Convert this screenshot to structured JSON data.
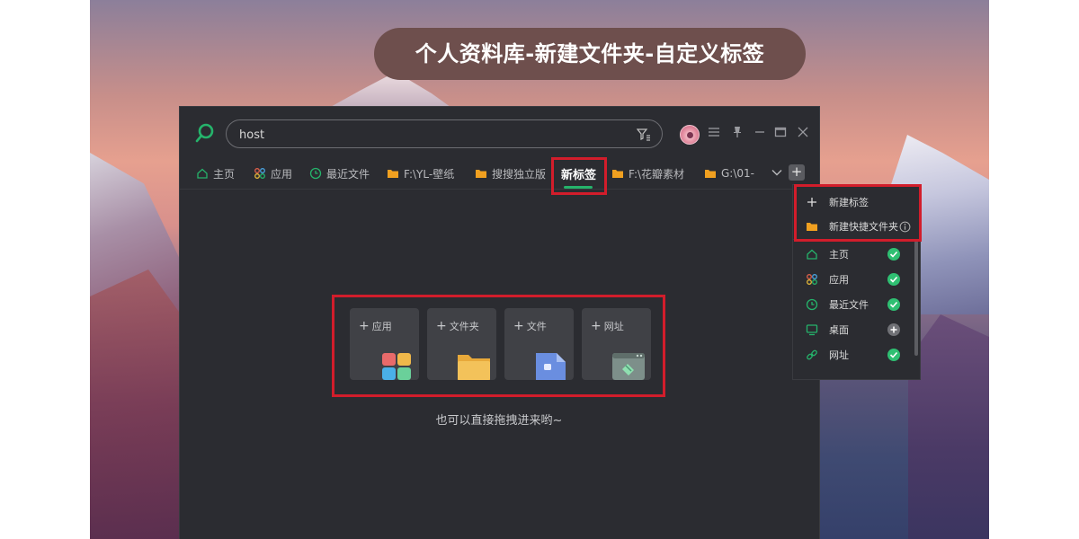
{
  "banner_title": "个人资料库-新建文件夹-自定义标签",
  "search": {
    "value": "host"
  },
  "tabs": [
    {
      "label": "主页",
      "icon": "home-icon"
    },
    {
      "label": "应用",
      "icon": "apps-icon"
    },
    {
      "label": "最近文件",
      "icon": "clock-icon"
    },
    {
      "label": "F:\\YL-壁纸",
      "icon": "folder-icon"
    },
    {
      "label": "搜搜独立版",
      "icon": "folder-icon"
    },
    {
      "label": "新标签",
      "icon": "",
      "active": true
    },
    {
      "label": "F:\\花瓣素材",
      "icon": "folder-icon"
    },
    {
      "label": "G:\\01-",
      "icon": "folder-icon"
    }
  ],
  "cards": [
    {
      "label": "应用",
      "icon": "apps-tile-icon"
    },
    {
      "label": "文件夹",
      "icon": "folder-tile-icon"
    },
    {
      "label": "文件",
      "icon": "file-tile-icon"
    },
    {
      "label": "网址",
      "icon": "browser-tile-icon"
    }
  ],
  "card_plus": "+",
  "hint": "也可以直接拖拽进来哟~",
  "menu": {
    "new_tag": "新建标签",
    "new_shortcut_folder": "新建快捷文件夹",
    "items": [
      {
        "label": "主页",
        "enabled": true
      },
      {
        "label": "应用",
        "enabled": true
      },
      {
        "label": "最近文件",
        "enabled": true
      },
      {
        "label": "桌面",
        "enabled": false
      },
      {
        "label": "网址",
        "enabled": true
      }
    ]
  },
  "colors": {
    "accent": "#25b36b",
    "highlight": "#d21d2b",
    "window_bg": "#2b2c31"
  }
}
